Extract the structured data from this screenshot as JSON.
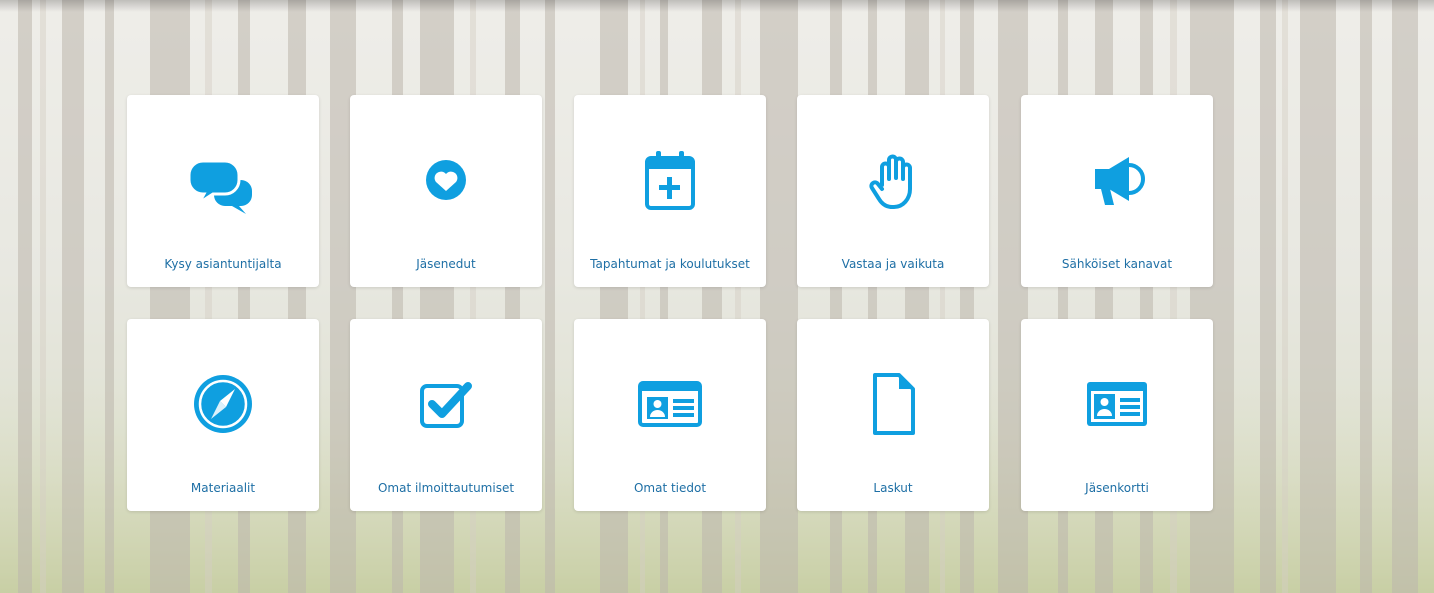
{
  "theme": {
    "accent": "#0f9fe0",
    "label_color": "#1e6fa5",
    "tile_background": "#ffffff"
  },
  "tiles": [
    {
      "label": "Kysy asiantuntijalta",
      "icon": "chat-bubbles-icon"
    },
    {
      "label": "Jäsenedut",
      "icon": "heart-icon"
    },
    {
      "label": "Tapahtumat ja koulutukset",
      "icon": "calendar-add-icon"
    },
    {
      "label": "Vastaa ja vaikuta",
      "icon": "raised-hand-icon"
    },
    {
      "label": "Sähköiset kanavat",
      "icon": "megaphone-icon"
    },
    {
      "label": "Materiaalit",
      "icon": "compass-icon"
    },
    {
      "label": "Omat ilmoittautumiset",
      "icon": "checkbox-icon"
    },
    {
      "label": "Omat tiedot",
      "icon": "id-card-outline-icon"
    },
    {
      "label": "Laskut",
      "icon": "document-icon"
    },
    {
      "label": "Jäsenkortti",
      "icon": "id-card-icon"
    }
  ]
}
